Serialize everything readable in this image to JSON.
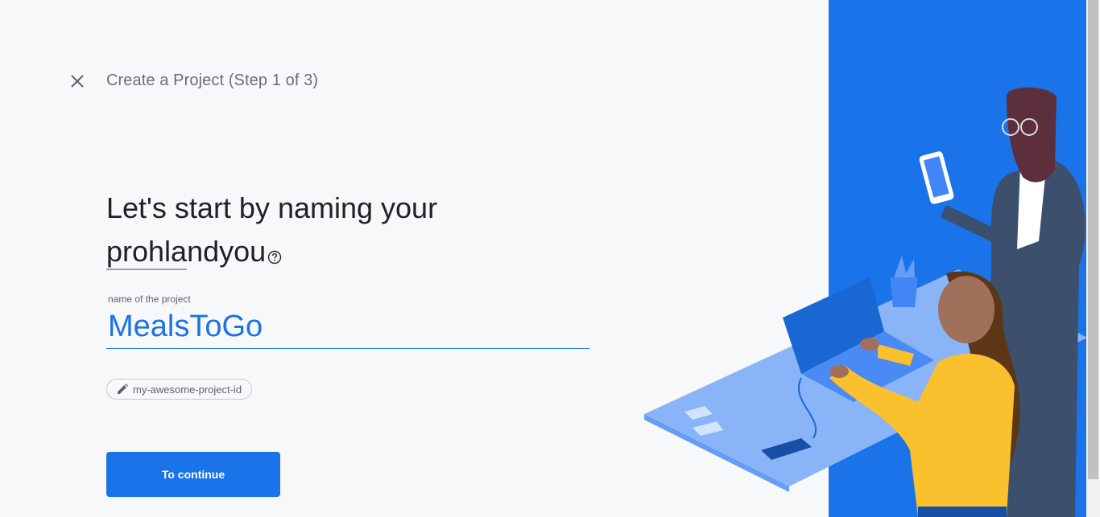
{
  "header": {
    "close_icon": "close-icon",
    "step_title": "Create a Project (Step 1 of 3)"
  },
  "main": {
    "heading_line1": "Let's start by naming your",
    "heading_line2": "prohlandyou",
    "help_icon": "help-circle-icon"
  },
  "project_name_field": {
    "label": "name of the project",
    "value": "MealsToGo"
  },
  "project_id_chip": {
    "icon": "pencil-icon",
    "label": "my-awesome-project-id"
  },
  "continue_button": {
    "label": "To continue"
  },
  "colors": {
    "accent": "#1a73e8",
    "background": "#f7f8fa",
    "illustration_blue": "#1a73e8"
  }
}
